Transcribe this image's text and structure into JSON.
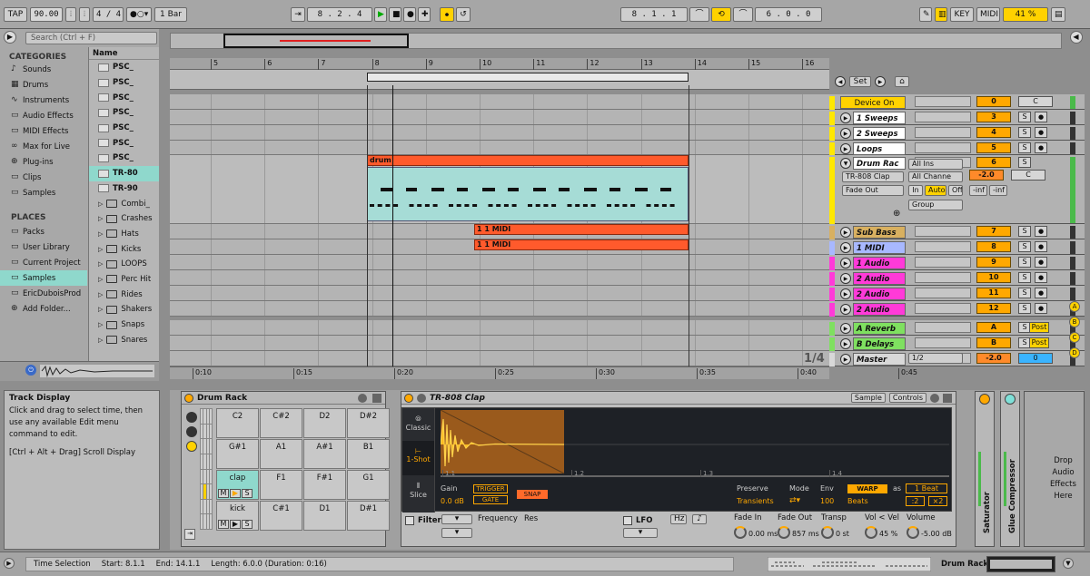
{
  "transport": {
    "tap": "TAP",
    "tempo": "90.00",
    "signature": "4 / 4",
    "quant": "1 Bar",
    "position": "8 .  2 .  4",
    "loop_start": "8 .  1 .  1",
    "loop_length": "6 .  0 .  0",
    "key": "KEY",
    "midi": "MIDI",
    "cpu": "41 %"
  },
  "browser": {
    "search_placeholder": "Search (Ctrl + F)",
    "categories_title": "CATEGORIES",
    "categories": [
      "Sounds",
      "Drums",
      "Instruments",
      "Audio Effects",
      "MIDI Effects",
      "Max for Live",
      "Plug-ins",
      "Clips",
      "Samples"
    ],
    "places_title": "PLACES",
    "places": [
      "Packs",
      "User Library",
      "Current Project",
      "Samples",
      "EricDuboisProd",
      "Add Folder..."
    ],
    "name_header": "Name",
    "files": [
      "PSC_",
      "PSC_",
      "PSC_",
      "PSC_",
      "PSC_",
      "PSC_",
      "PSC_",
      "TR-80",
      "TR-90"
    ],
    "folders": [
      "Combi_",
      "Crashes",
      "Hats",
      "Kicks",
      "LOOPS",
      "Perc Hit",
      "Rides",
      "Shakers",
      "Snaps",
      "Snares"
    ]
  },
  "ruler": {
    "bars": [
      "5",
      "6",
      "7",
      "8",
      "9",
      "10",
      "11",
      "12",
      "13",
      "14",
      "15",
      "16"
    ],
    "times": [
      "0:10",
      "0:15",
      "0:20",
      "0:25",
      "0:30",
      "0:35",
      "0:40",
      "0:45"
    ],
    "set": "Set",
    "zoom": "1/4"
  },
  "clips": {
    "drum": "drum",
    "midi1": "1 1 MIDI",
    "midi2": "1 1 MIDI"
  },
  "tracks": [
    {
      "name": "Device On",
      "num": "0",
      "extra": "C",
      "color": "#ffd200"
    },
    {
      "name": "1 Sweeps",
      "num": "3",
      "extra": "S",
      "color": "#ffffff"
    },
    {
      "name": "2 Sweeps",
      "num": "4",
      "extra": "S",
      "color": "#ffffff"
    },
    {
      "name": "Loops",
      "num": "5",
      "extra": "S",
      "color": "#ffffff"
    },
    {
      "name": "Drum Rac",
      "num": "6",
      "extra": "S",
      "color": "#ffffff"
    },
    {
      "name": "Sub Bass",
      "num": "7",
      "extra": "S",
      "color": "#d8b060"
    },
    {
      "name": "1 MIDI",
      "num": "8",
      "extra": "S",
      "color": "#a8b8ff"
    },
    {
      "name": "1 Audio",
      "num": "9",
      "extra": "S",
      "color": "#ff3ad8"
    },
    {
      "name": "2 Audio",
      "num": "10",
      "extra": "S",
      "color": "#ff3ad8"
    },
    {
      "name": "2 Audio",
      "num": "11",
      "extra": "S",
      "color": "#ff3ad8"
    },
    {
      "name": "2 Audio",
      "num": "12",
      "extra": "S",
      "color": "#ff3ad8"
    },
    {
      "name": "A Reverb",
      "num": "A",
      "extra": "S",
      "color": "#7fe060"
    },
    {
      "name": "B Delays",
      "num": "B",
      "extra": "S",
      "color": "#7fe060"
    },
    {
      "name": "Master",
      "num": "-2.0",
      "extra": "0",
      "color": "#d8d8d8"
    }
  ],
  "drumtrack": {
    "input": "All Ins",
    "chain": "TR-808 Clap",
    "channel": "All Channe",
    "fade": "Fade Out",
    "in": "In",
    "auto": "Auto",
    "off": "Off",
    "inf1": "-inf",
    "inf2": "-inf",
    "group": "Group",
    "vol": "-2.0",
    "pan": "C",
    "master_sel": "1/2",
    "post": "Post"
  },
  "info": {
    "title": "Track Display",
    "body": "Click and drag to select time, then use any available Edit menu command to edit.",
    "hint": "[Ctrl + Alt + Drag] Scroll Display"
  },
  "drumrack": {
    "title": "Drum Rack",
    "pads": [
      [
        "C2",
        "C#2",
        "D2",
        "D#2"
      ],
      [
        "G#1",
        "A1",
        "A#1",
        "B1"
      ],
      [
        "clap",
        "F1",
        "F#1",
        "G1"
      ],
      [
        "kick",
        "C#1",
        "D1",
        "D#1"
      ]
    ],
    "m": "M",
    "s": "S"
  },
  "simpler": {
    "title": "TR-808 Clap",
    "tab_sample": "Sample",
    "tab_controls": "Controls",
    "classic": "Classic",
    "oneshot": "1-Shot",
    "slice": "Slice",
    "gain": "Gain",
    "gain_val": "0.0 dB",
    "trigger": "TRIGGER",
    "gate": "GATE",
    "snap": "SNAP",
    "preserve": "Preserve",
    "transients": "Transients",
    "mode": "Mode",
    "env": "Env",
    "env_val": "100",
    "warp": "WARP",
    "as": "as",
    "beats": "Beats",
    "beat": "1 Beat",
    "div": ":2",
    "mul": "×2",
    "marks": [
      "1.1",
      "1.2",
      "1.3",
      "1.4"
    ],
    "filter": "Filter",
    "frequency": "Frequency",
    "res": "Res",
    "lfo": "LFO",
    "hz": "Hz",
    "note": "♪",
    "fade_in": "Fade In",
    "fade_in_val": "0.00 ms",
    "fade_out": "Fade Out",
    "fade_out_val": "857 ms",
    "transp": "Transp",
    "transp_val": "0 st",
    "vel": "Vol < Vel",
    "vel_val": "45 %",
    "volume": "Volume",
    "volume_val": "-5.00 dB"
  },
  "chain": [
    "Saturator",
    "Glue Compressor"
  ],
  "drop": "Drop Audio Effects Here",
  "status": {
    "label": "Time Selection",
    "start": "Start: 8.1.1",
    "end": "End: 14.1.1",
    "length": "Length: 6.0.0 (Duration: 0:16)",
    "device": "Drum Rack"
  },
  "side": [
    "A",
    "B",
    "C",
    "D"
  ]
}
